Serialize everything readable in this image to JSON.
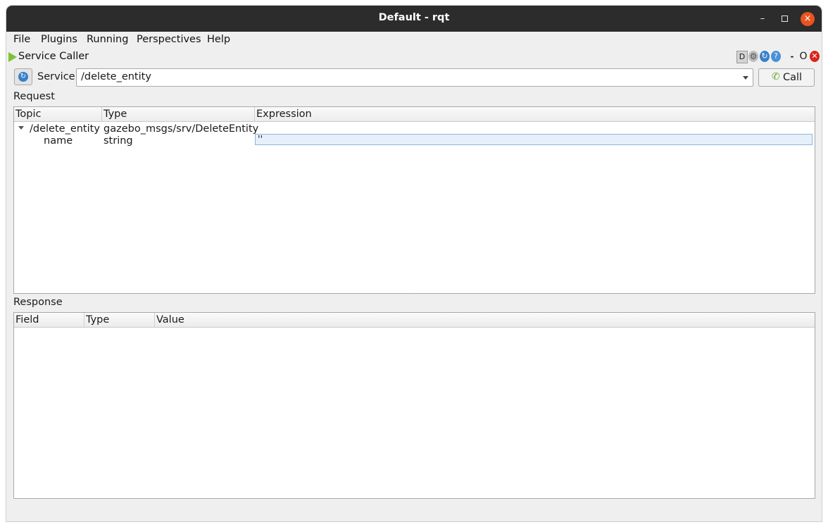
{
  "window": {
    "title": "Default - rqt"
  },
  "window_controls": {
    "minimize": "–",
    "close": "×"
  },
  "menubar": [
    {
      "label": "File"
    },
    {
      "label": "Plugins"
    },
    {
      "label": "Running"
    },
    {
      "label": "Perspectives"
    },
    {
      "label": "Help"
    }
  ],
  "plugin": {
    "title": "Service Caller",
    "controls": {
      "d": "D",
      "dash": "-",
      "o": "O"
    }
  },
  "service": {
    "label": "Service",
    "selected": "/delete_entity",
    "call_label": "Call"
  },
  "request": {
    "section_label": "Request",
    "columns": [
      "Topic",
      "Type",
      "Expression"
    ],
    "rows": [
      {
        "topic": "/delete_entity",
        "type": "gazebo_msgs/srv/DeleteEntity",
        "expression": ""
      },
      {
        "topic": "name",
        "type": "string",
        "expression": "''"
      }
    ]
  },
  "response": {
    "section_label": "Response",
    "columns": [
      "Field",
      "Type",
      "Value"
    ]
  },
  "colors": {
    "titlebar": "#2c2c2c",
    "close_button": "#e95420",
    "accent_blue": "#3a80c9",
    "play_green": "#7ec234"
  }
}
